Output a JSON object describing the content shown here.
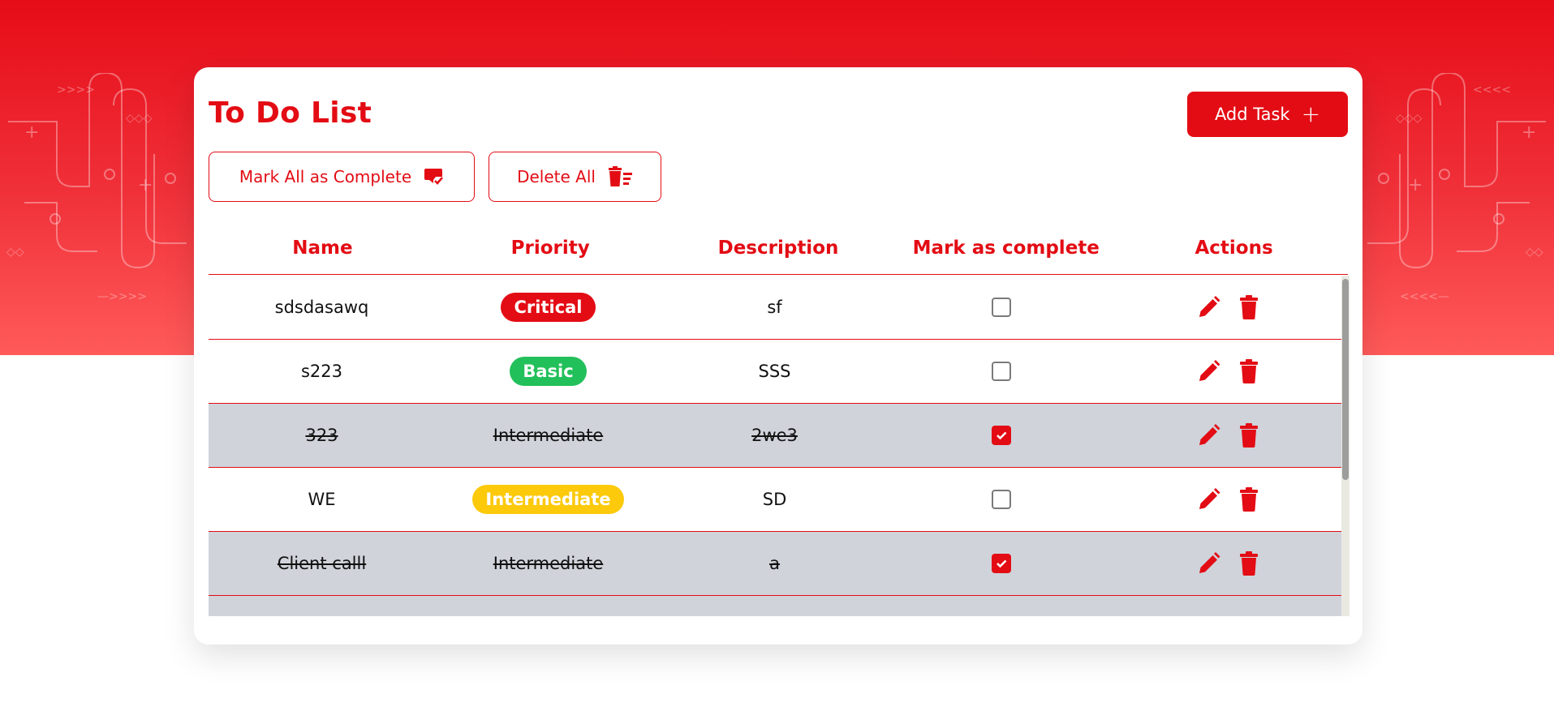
{
  "app": {
    "title": "To Do List",
    "add_task_label": "Add Task",
    "mark_all_label": "Mark All as Complete",
    "delete_all_label": "Delete All"
  },
  "colors": {
    "brand_red": "#e30c14",
    "completed_row": "#d0d3da",
    "critical": "#e30c14",
    "basic": "#22c05a",
    "intermediate": "#fcc90b"
  },
  "table": {
    "columns": [
      "Name",
      "Priority",
      "Description",
      "Mark as complete",
      "Actions"
    ],
    "rows": [
      {
        "name": "sdsdasawq",
        "priority": "Critical",
        "description": "sf",
        "completed": false
      },
      {
        "name": "s223",
        "priority": "Basic",
        "description": "SSS",
        "completed": false
      },
      {
        "name": "323",
        "priority": "Intermediate",
        "description": "2we3",
        "completed": true
      },
      {
        "name": "WE",
        "priority": "Intermediate",
        "description": "SD",
        "completed": false
      },
      {
        "name": "Client calll",
        "priority": "Intermediate",
        "description": "a",
        "completed": true
      }
    ]
  },
  "icons": {
    "mark_all": "chat-check-icon",
    "delete_all": "trash-list-icon",
    "edit": "pencil-icon",
    "delete": "trash-icon",
    "add": "plus-icon"
  }
}
